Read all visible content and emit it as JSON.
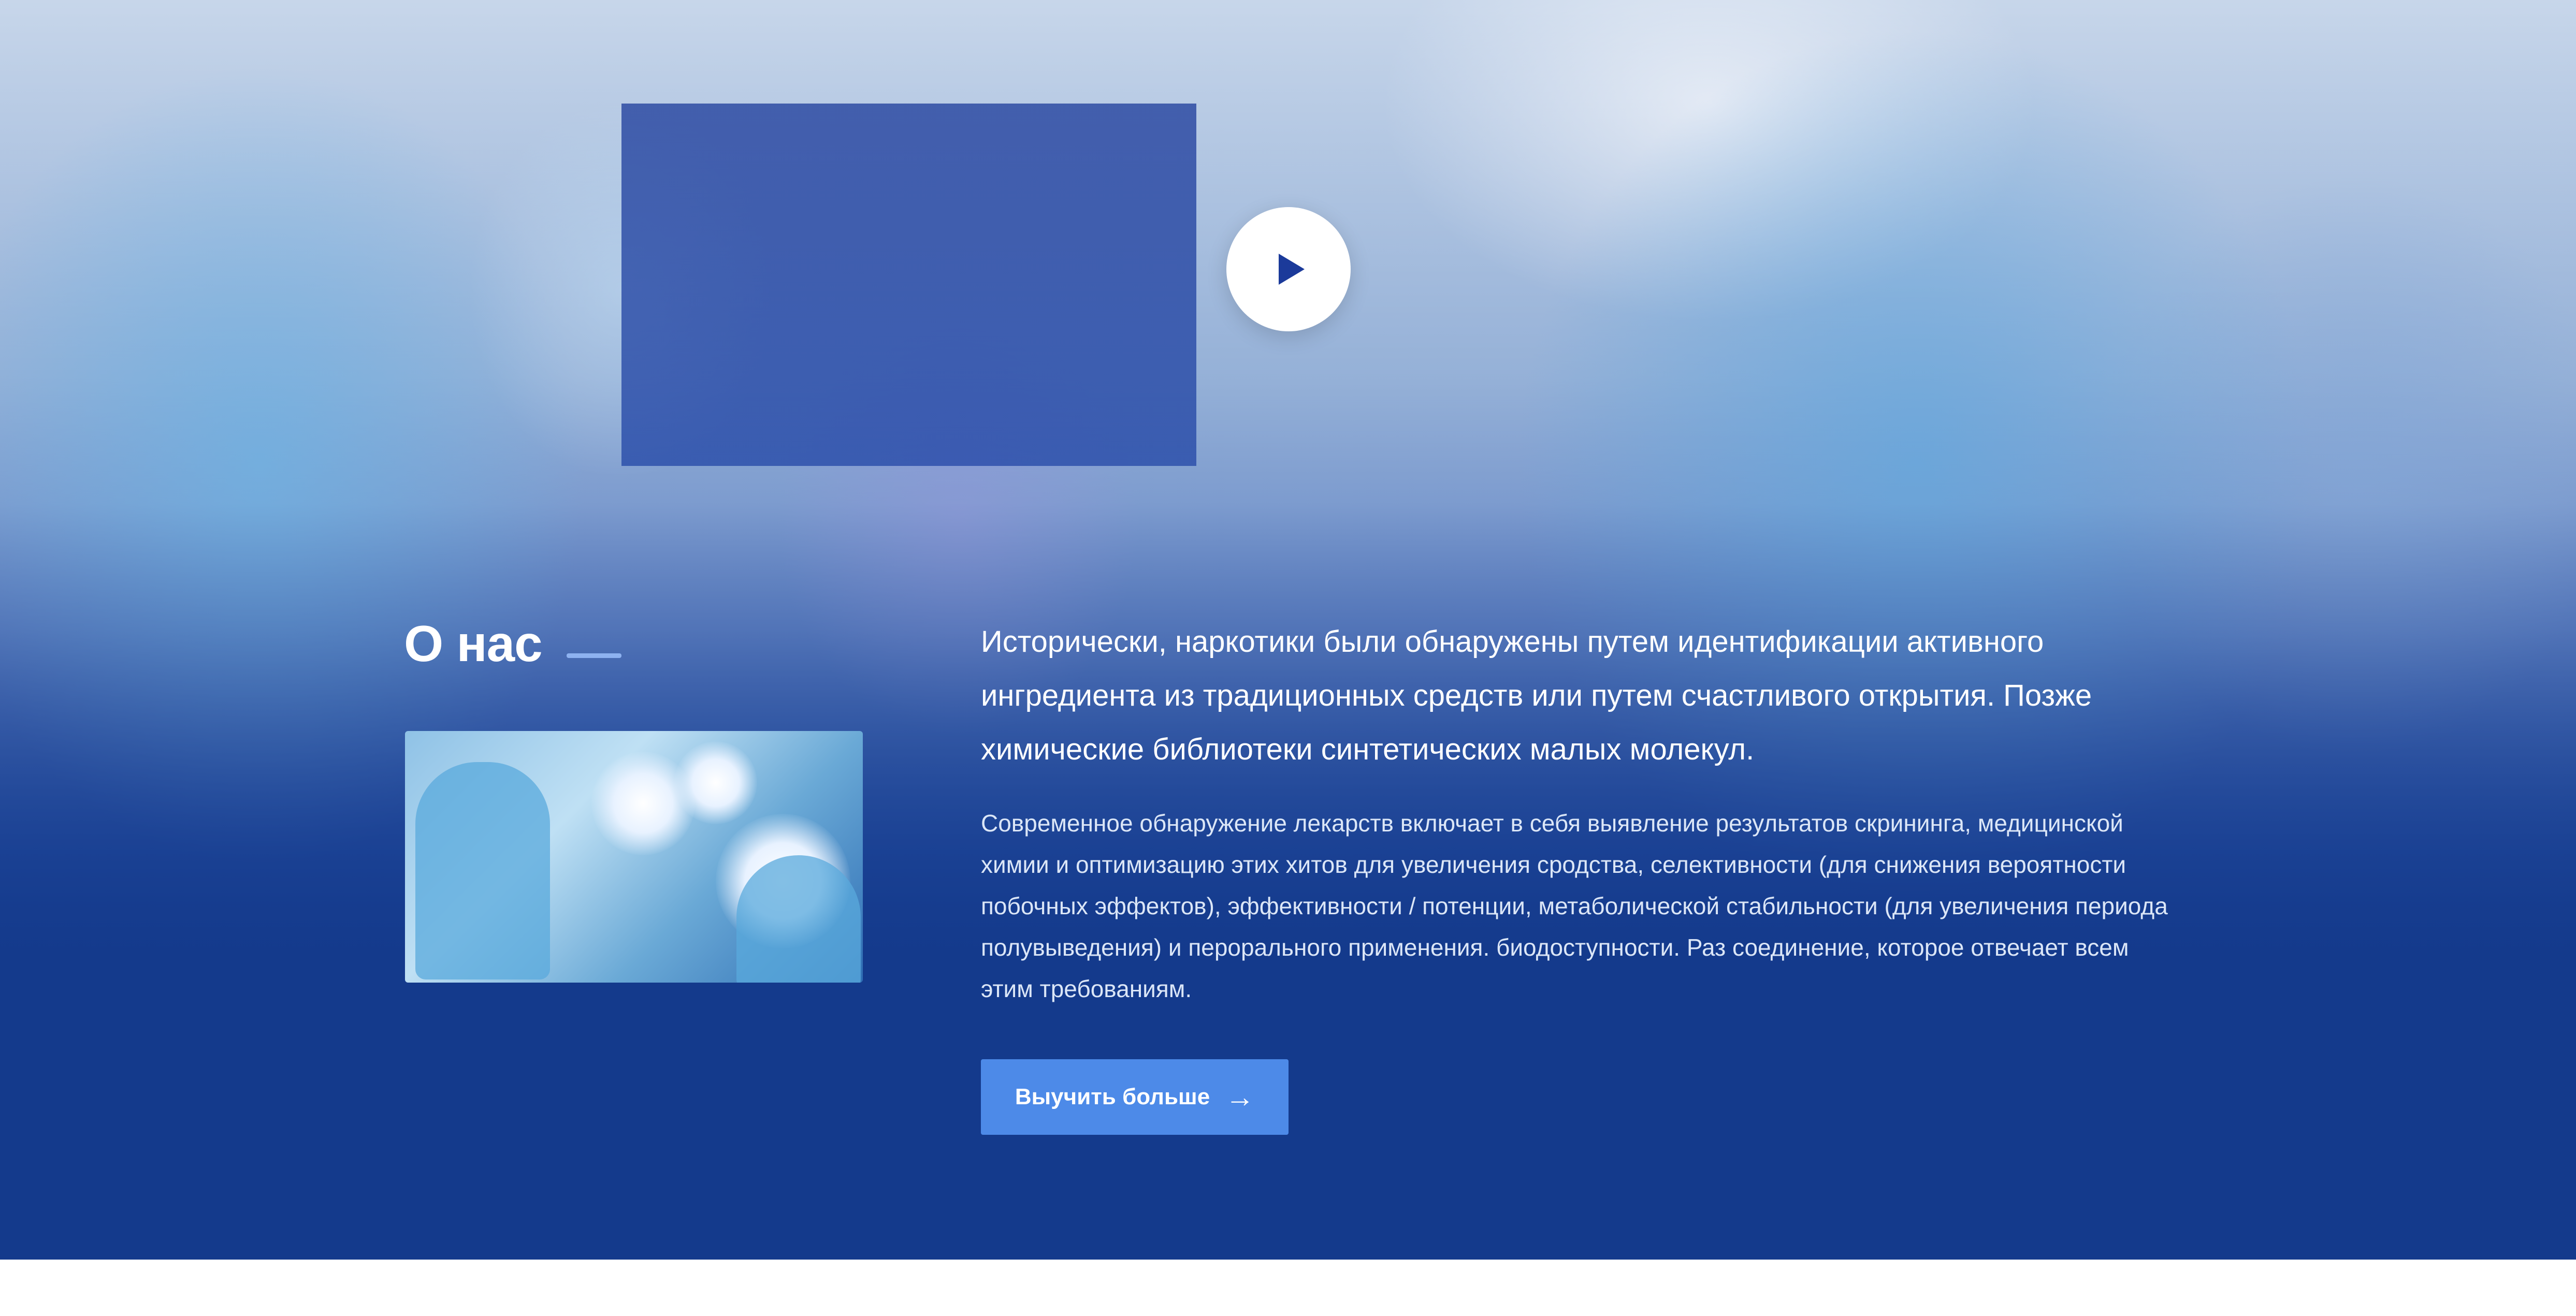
{
  "about": {
    "title": "О нас",
    "lead": "Исторически, наркотики были обнаружены путем идентификации активного ингредиента из традиционных средств или путем счастливого открытия. Позже химические библиотеки синтетических малых молекул.",
    "body": "Современное обнаружение лекарств включает в себя выявление результатов скрининга, медицинской химии и оптимизацию этих хитов для увеличения сродства, селективности (для снижения вероятности побочных эффектов), эффективности / потенции, метаболической стабильности (для увеличения периода полувыведения) и перорального применения. биодоступности. Раз соединение, которое отвечает всем этим требованиям.",
    "cta_label": "Выучить больше",
    "cta_icon": "arrow-right-icon"
  },
  "video": {
    "play_icon": "play-icon"
  },
  "colors": {
    "section_bg": "#143a8c",
    "accent_button": "#4d8ae8",
    "title_underline": "#8eb2f0",
    "play_icon": "#1b3a9a"
  }
}
